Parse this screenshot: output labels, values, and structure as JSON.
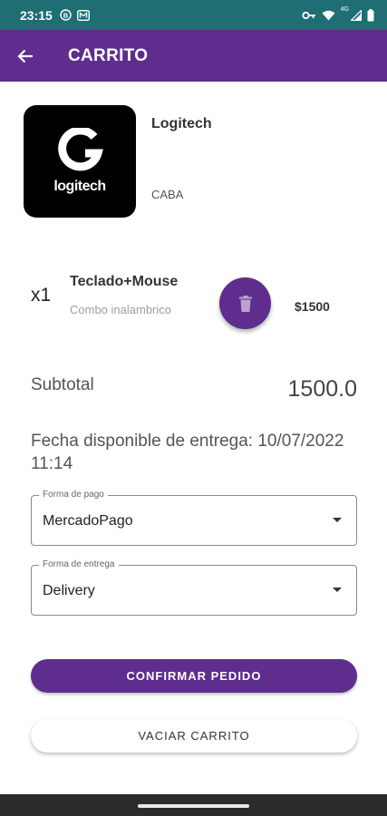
{
  "status_bar": {
    "time": "23:15",
    "signal_label": "4G",
    "icons_left": [
      "status-b-icon",
      "status-m-icon"
    ],
    "icons_right": [
      "vpn-key-icon",
      "wifi-icon",
      "signal-icon",
      "battery-icon"
    ]
  },
  "app_bar": {
    "title": "CARRITO",
    "back_icon": "arrow-back-icon"
  },
  "store": {
    "logo_text": "logitech",
    "name": "Logitech",
    "location": "CABA"
  },
  "cart_item": {
    "quantity": "x1",
    "name": "Teclado+Mouse",
    "description": "Combo inalambrico",
    "price": "$1500",
    "delete_icon": "trash-icon"
  },
  "summary": {
    "subtotal_label": "Subtotal",
    "subtotal_value": "1500.0",
    "delivery_date": "Fecha disponible de entrega: 10/07/2022 11:14"
  },
  "payment": {
    "label": "Forma de pago",
    "value": "MercadoPago"
  },
  "delivery": {
    "label": "Forma de entrega",
    "value": "Delivery"
  },
  "actions": {
    "confirm_label": "CONFIRMAR PEDIDO",
    "empty_label": "VACIAR CARRITO"
  },
  "colors": {
    "status_bar": "#1e6e74",
    "primary": "#5e2d8d",
    "nav_bar": "#2b2b2b"
  }
}
